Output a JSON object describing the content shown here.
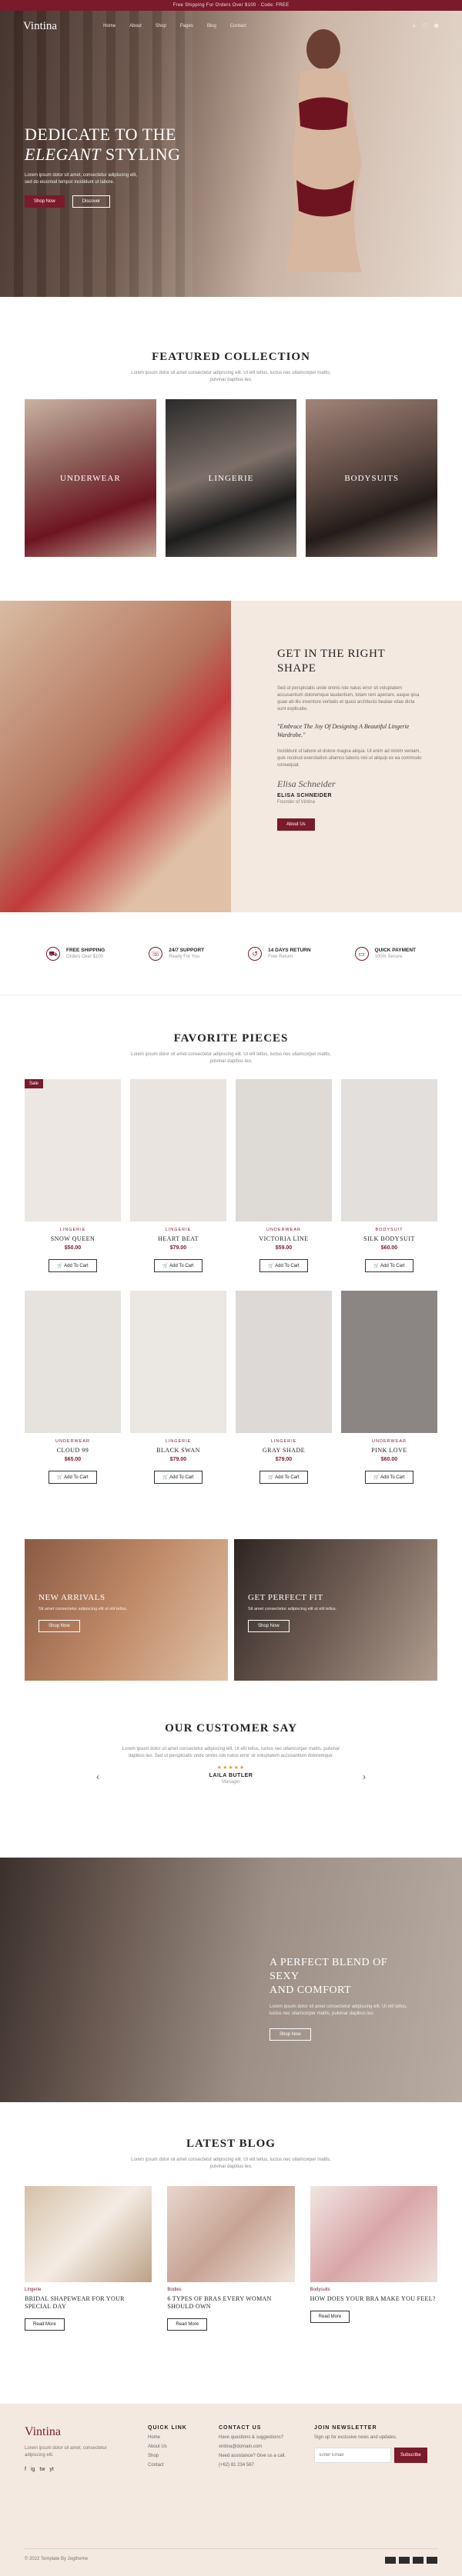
{
  "topbar": {
    "text": "Free Shipping For Orders Over $100 · Code: FREE"
  },
  "nav": {
    "logo": "Vintina",
    "menu": [
      "Home",
      "About",
      "Shop",
      "Pages",
      "Blog",
      "Contact"
    ],
    "icons": [
      "search-icon",
      "heart-icon",
      "cart-icon"
    ]
  },
  "hero": {
    "title_line1": "DEDICATE TO THE",
    "title_line2_italic": "ELEGANT",
    "title_line2_rest": " STYLING",
    "text": "Lorem ipsum dolor sit amet, consectetur adipiscing elit, sed do eiusmod tempor incididunt ut labore.",
    "primary_btn": "Shop Now",
    "secondary_btn": "Discover"
  },
  "featured": {
    "title": "FEATURED COLLECTION",
    "subtitle": "Lorem ipsum dolor sit amet consectetur adipiscing elit. Ut elit tellus, luctus nec ullamcorper mattis, pulvinar dapibus leo.",
    "categories": [
      "UNDERWEAR",
      "LINGERIE",
      "BODYSUITS"
    ]
  },
  "shape": {
    "title_line1": "GET IN THE RIGHT",
    "title_line2": "SHAPE",
    "body": "Sed ut perspiciatis unde omnis iste natus error sit voluptatem accusantium doloremque laudantium, totam rem aperiam, eaque ipsa quae ab illo inventore veritatis et quasi architecto beatae vitae dicta sunt explicabo.",
    "quote": "\"Embrace The Joy Of Designing A Beautiful Lingerie Wardrobe.\"",
    "body2": "Incididunt ut labore et dolore magna aliqua. Ut enim ad minim veniam, quis nostrud exercitation ullamco laboris nisi ut aliquip ex ea commodo consequat.",
    "signature": "Elisa Schneider",
    "name": "ELISA SCHNEIDER",
    "role": "Founder of Vintina",
    "button": "About Us"
  },
  "features": [
    {
      "icon": "truck-icon",
      "title": "FREE SHIPPING",
      "sub": "Orders Over $100"
    },
    {
      "icon": "headset-icon",
      "title": "24/7 SUPPORT",
      "sub": "Ready For You"
    },
    {
      "icon": "return-icon",
      "title": "14 DAYS RETURN",
      "sub": "Free Return"
    },
    {
      "icon": "card-icon",
      "title": "QUICK PAYMENT",
      "sub": "100% Secure"
    }
  ],
  "favorites": {
    "title": "FAVORITE PIECES",
    "subtitle": "Lorem ipsum dolor sit amet consectetur adipiscing elit. Ut elit tellus, luctus nec ullamcorper mattis, pulvinar dapibus leo.",
    "add_label": "Add To Cart",
    "sale_label": "Sale",
    "products": [
      {
        "cat": "LINGERIE",
        "name": "SNOW QUEEN",
        "price": "$50.00",
        "sale": true,
        "tone": "#ece7e2"
      },
      {
        "cat": "LINGERIE",
        "name": "HEART BEAT",
        "price": "$79.00",
        "sale": false,
        "tone": "#e9e4df"
      },
      {
        "cat": "UNDERWEAR",
        "name": "VICTORIA LINE",
        "price": "$59.00",
        "sale": false,
        "tone": "#dedad6"
      },
      {
        "cat": "BODYSUIT",
        "name": "SILK BODYSUIT",
        "price": "$60.00",
        "sale": false,
        "tone": "#e2dfdc"
      },
      {
        "cat": "UNDERWEAR",
        "name": "CLOUD 99",
        "price": "$65.00",
        "sale": false,
        "tone": "#e6e2de"
      },
      {
        "cat": "LINGERIE",
        "name": "BLACK SWAN",
        "price": "$79.00",
        "sale": false,
        "tone": "#eae6e2"
      },
      {
        "cat": "LINGERIE",
        "name": "GRAY SHADE",
        "price": "$79.00",
        "sale": false,
        "tone": "#dcd9d6"
      },
      {
        "cat": "UNDERWEAR",
        "name": "PINK LOVE",
        "price": "$60.00",
        "sale": false,
        "tone": "#8b8683"
      }
    ]
  },
  "promos": [
    {
      "title": "NEW ARRIVALS",
      "text": "Sit amet consectetur adipiscing elit ut elit tellus.",
      "btn": "Shop Now"
    },
    {
      "title": "GET PERFECT FIT",
      "text": "Sit amet consectetur adipiscing elit ut elit tellus.",
      "btn": "Shop Now"
    }
  ],
  "testimonial": {
    "title": "OUR CUSTOMER SAY",
    "quote": "Lorem ipsum dolor sit amet consectetur adipiscing elit. Ut elit tellus, luctus nec ullamcorper mattis, pulvinar dapibus leo. Sed ut perspiciatis unde omnis iste natus error sit voluptatem accusantium doloremque.",
    "stars": "★★★★★",
    "name": "LAILA BUTLER",
    "role": "Manager"
  },
  "blend": {
    "title_line1": "A PERFECT BLEND OF SEXY",
    "title_line2": "AND COMFORT",
    "text": "Lorem ipsum dolor sit amet consectetur adipiscing elit. Ut elit tellus, luctus nec ullamcorper mattis, pulvinar dapibus leo.",
    "btn": "Shop Now"
  },
  "blog": {
    "title": "LATEST BLOG",
    "subtitle": "Lorem ipsum dolor sit amet consectetur adipiscing elit. Ut elit tellus, luctus nec ullamcorper mattis, pulvinar dapibus leo.",
    "btn": "Read More",
    "posts": [
      {
        "tag": "Lingerie",
        "title": "BRIDAL SHAPEWEAR FOR YOUR SPECIAL DAY"
      },
      {
        "tag": "Bodies",
        "title": "6 TYPES OF BRAS EVERY WOMAN SHOULD OWN"
      },
      {
        "tag": "Bodysuits",
        "title": "HOW DOES YOUR BRA MAKE YOU FEEL?"
      }
    ]
  },
  "footer": {
    "logo": "Vintina",
    "about": "Lorem ipsum dolor sit amet, consectetur adipiscing elit.",
    "social": [
      "f",
      "ig",
      "tw",
      "yt"
    ],
    "quick_title": "QUICK LINK",
    "quick_links": [
      "Home",
      "About Us",
      "Shop",
      "Contact"
    ],
    "contact_title": "CONTACT US",
    "contact_lines": [
      "Have questions & suggestions?",
      "vintina@domain.com",
      "Need assistance? Give us a call.",
      "(+62) 81 234 567"
    ],
    "newsletter_title": "JOIN NEWSLETTER",
    "newsletter_text": "Sign up for exclusive news and updates.",
    "email_placeholder": "Enter Email",
    "subscribe": "Subscribe",
    "copyright": "© 2022 Template By Jegtheme"
  }
}
